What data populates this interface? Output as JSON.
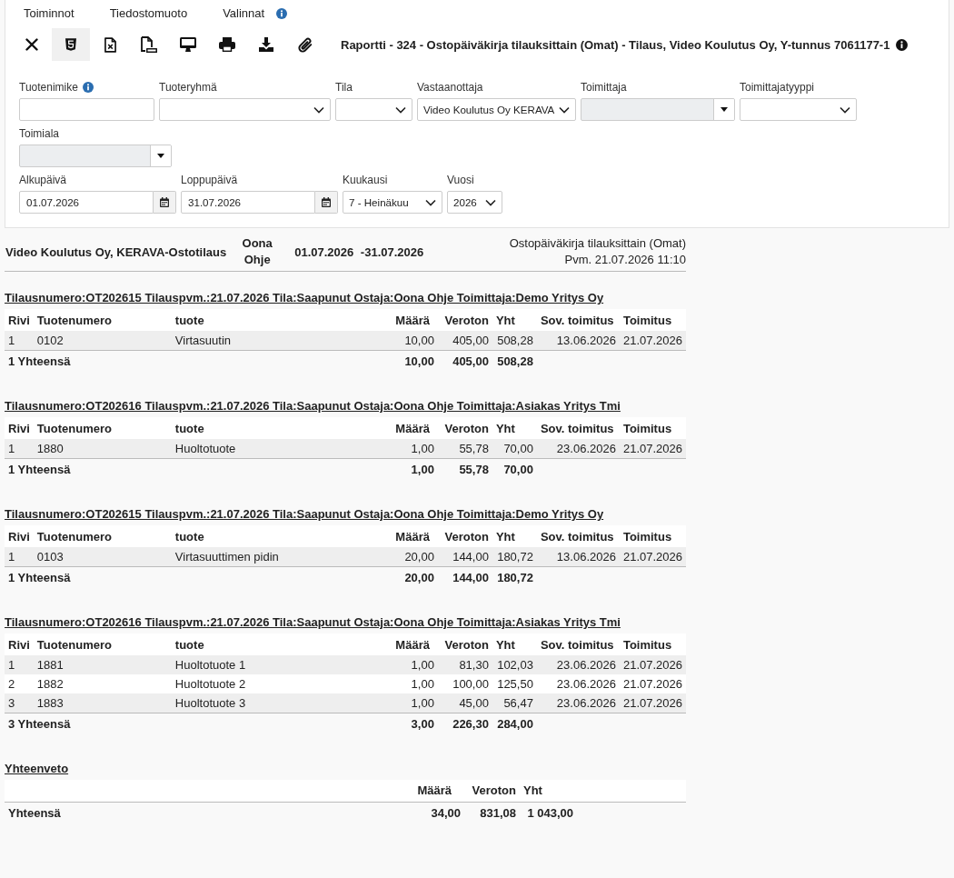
{
  "menu": [
    {
      "label": "Toiminnot",
      "info": false
    },
    {
      "label": "Tiedostomuoto",
      "info": false
    },
    {
      "label": "Valinnat",
      "info": true
    }
  ],
  "toolbar": {
    "buttons": [
      {
        "kind": "close",
        "selected": false
      },
      {
        "kind": "html",
        "selected": true
      },
      {
        "kind": "excel",
        "selected": false
      },
      {
        "kind": "pdf",
        "selected": false
      },
      {
        "kind": "screen",
        "selected": false
      },
      {
        "kind": "print",
        "selected": false
      },
      {
        "kind": "download",
        "selected": false
      },
      {
        "kind": "attachment",
        "selected": false
      }
    ],
    "title": "Raportti - 324 - Ostopäiväkirja tilauksittain (Omat) - Tilaus, Video Koulutus Oy, Y-tunnus 7061177-1"
  },
  "filter_rows": [
    {
      "fields": [
        {
          "label": "Tuotenimike",
          "kind": "text",
          "info": true,
          "disabled": false
        },
        {
          "label": "Tuoteryhmä",
          "kind": "select",
          "info": false,
          "disabled": false
        },
        {
          "label": "Tila",
          "kind": "select",
          "info": false,
          "disabled": false
        },
        {
          "label": "Vastaanottaja",
          "kind": "select",
          "info": false,
          "disabled": false,
          "value": "Video Koulutus Oy KERAVA"
        },
        {
          "label": "Toimittaja",
          "kind": "combo",
          "info": false,
          "disabled": true
        },
        {
          "label": "Toimittajatyyppi",
          "kind": "select",
          "info": false,
          "disabled": false
        }
      ]
    },
    {
      "fields": [
        {
          "label": "Toimiala",
          "kind": "combo",
          "info": false,
          "disabled": true
        }
      ]
    },
    {
      "fields": [
        {
          "label": "Alkupäivä",
          "kind": "date",
          "info": false,
          "disabled": false,
          "value": "01.07.2026"
        },
        {
          "label": "Loppupäivä",
          "kind": "date",
          "info": false,
          "disabled": false,
          "value": "31.07.2026"
        },
        {
          "label": "Kuukausi",
          "kind": "select",
          "info": false,
          "disabled": false,
          "value": "7 - Heinäkuu"
        },
        {
          "label": "Vuosi",
          "kind": "select",
          "info": false,
          "disabled": false,
          "value": "2026"
        }
      ]
    }
  ],
  "report_header": {
    "company": "Video Koulutus Oy, KERAVA-Ostotilaus",
    "person": "Oona Ohje",
    "period": "01.07.2026 -31.07.2026",
    "report_name": "Ostopäiväkirja tilauksittain (Omat)",
    "printed": "Pvm. 21.07.2026 11:10"
  },
  "orders": [
    {
      "heading": "Tilausnumero:OT202615 Tilauspvm.:21.07.2026 Tila:Saapunut Ostaja:Oona Ohje Toimittaja:Demo Yritys Oy",
      "columns": [
        "Rivi",
        "Tuotenumero",
        "tuote",
        "Määrä",
        "Veroton",
        "Yht",
        "Sov. toimitus",
        "Toimitus"
      ],
      "rows": [
        [
          "1",
          "0102",
          "Virtasuutin",
          "10,00",
          "405,00",
          "508,28",
          "13.06.2026",
          "21.07.2026"
        ]
      ],
      "total": {
        "label": "1 Yhteensä",
        "values": [
          "10,00",
          "405,00",
          "508,28"
        ]
      }
    },
    {
      "heading": "Tilausnumero:OT202616 Tilauspvm.:21.07.2026 Tila:Saapunut Ostaja:Oona Ohje Toimittaja:Asiakas Yritys Tmi",
      "columns": [
        "Rivi",
        "Tuotenumero",
        "tuote",
        "Määrä",
        "Veroton",
        "Yht",
        "Sov. toimitus",
        "Toimitus"
      ],
      "rows": [
        [
          "1",
          "1880",
          "Huoltotuote",
          "1,00",
          "55,78",
          "70,00",
          "23.06.2026",
          "21.07.2026"
        ]
      ],
      "total": {
        "label": "1 Yhteensä",
        "values": [
          "1,00",
          "55,78",
          "70,00"
        ]
      }
    },
    {
      "heading": "Tilausnumero:OT202615 Tilauspvm.:21.07.2026 Tila:Saapunut Ostaja:Oona Ohje Toimittaja:Demo Yritys Oy",
      "columns": [
        "Rivi",
        "Tuotenumero",
        "tuote",
        "Määrä",
        "Veroton",
        "Yht",
        "Sov. toimitus",
        "Toimitus"
      ],
      "rows": [
        [
          "1",
          "0103",
          "Virtasuuttimen pidin",
          "20,00",
          "144,00",
          "180,72",
          "13.06.2026",
          "21.07.2026"
        ]
      ],
      "total": {
        "label": "1 Yhteensä",
        "values": [
          "20,00",
          "144,00",
          "180,72"
        ]
      }
    },
    {
      "heading": "Tilausnumero:OT202616 Tilauspvm.:21.07.2026 Tila:Saapunut Ostaja:Oona Ohje Toimittaja:Asiakas Yritys Tmi",
      "columns": [
        "Rivi",
        "Tuotenumero",
        "tuote",
        "Määrä",
        "Veroton",
        "Yht",
        "Sov. toimitus",
        "Toimitus"
      ],
      "rows": [
        [
          "1",
          "1881",
          "Huoltotuote 1",
          "1,00",
          "81,30",
          "102,03",
          "23.06.2026",
          "21.07.2026"
        ],
        [
          "2",
          "1882",
          "Huoltotuote 2",
          "1,00",
          "100,00",
          "125,50",
          "23.06.2026",
          "21.07.2026"
        ],
        [
          "3",
          "1883",
          "Huoltotuote 3",
          "1,00",
          "45,00",
          "56,47",
          "23.06.2026",
          "21.07.2026"
        ]
      ],
      "total": {
        "label": "3 Yhteensä",
        "values": [
          "3,00",
          "226,30",
          "284,00"
        ]
      }
    }
  ],
  "summary": {
    "title": "Yhteenveto",
    "columns": [
      "Määrä",
      "Veroton",
      "Yht"
    ],
    "total": {
      "label": "Yhteensä",
      "values": [
        "34,00",
        "831,08",
        "1 043,00"
      ]
    }
  }
}
